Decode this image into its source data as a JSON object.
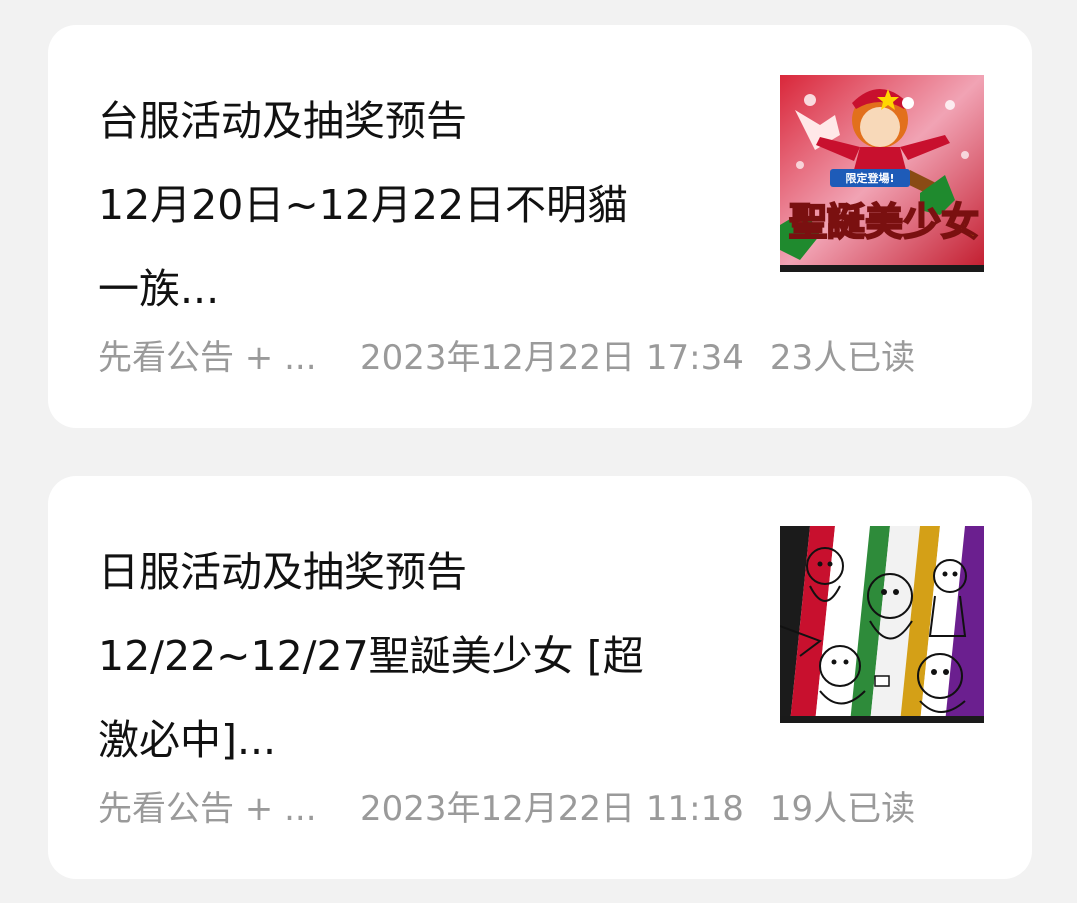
{
  "articles": [
    {
      "title_lines": [
        "台服活动及抽奖预告",
        "12月20日~12月22日不明貓",
        "一族..."
      ],
      "source": "先看公告 + ...",
      "time": "2023年12月22日 17:34",
      "reads": "23人已读",
      "thumbnail": {
        "badge": "限定登場!",
        "caption": "聖誕美少女"
      }
    },
    {
      "title_lines": [
        "日服活动及抽奖预告",
        "12/22~12/27聖誕美少女 [超",
        "激必中]..."
      ],
      "source": "先看公告 + ...",
      "time": "2023年12月22日 11:18",
      "reads": "19人已读",
      "thumbnail": {}
    }
  ]
}
